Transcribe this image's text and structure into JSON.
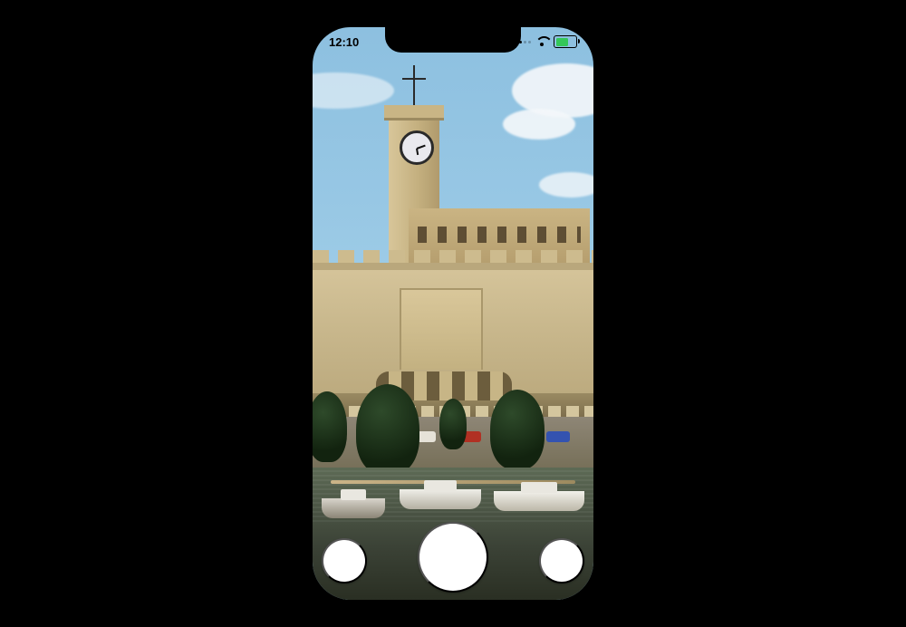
{
  "status_bar": {
    "time": "12:10",
    "cellular_bars_filled": 2,
    "cellular_bars_total": 4,
    "wifi": true,
    "battery_percent": 55,
    "battery_charging": true,
    "battery_fill_color": "#34c759"
  },
  "controls": {
    "left_button_label": "",
    "shutter_label": "",
    "right_button_label": ""
  }
}
